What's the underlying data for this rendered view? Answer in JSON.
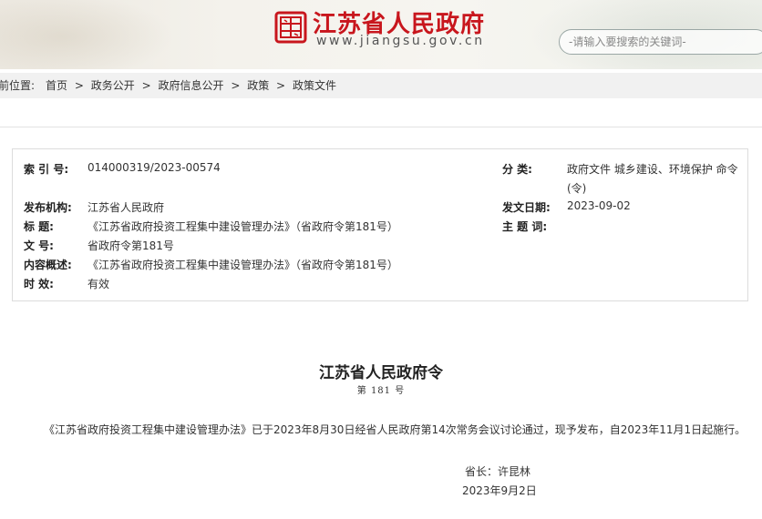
{
  "header": {
    "site_title": "江苏省人民政府",
    "site_url": "www.jiangsu.gov.cn",
    "search_placeholder": "-请输入要搜索的关键词-",
    "brand_color": "#c8161d"
  },
  "breadcrumb": {
    "label": "前位置:",
    "items": [
      "首页",
      "政务公开",
      "政府信息公开",
      "政策",
      "政策文件"
    ],
    "separator": ">"
  },
  "info": {
    "index_label": "索 引 号:",
    "index_value": "014000319/2023-00574",
    "category_label": "分 类:",
    "category_value_line1": "政府文件 城乡建设、环境保护 命令",
    "category_value_line2": "(令)",
    "publisher_label": "发布机构:",
    "publisher_value": "江苏省人民政府",
    "date_label": "发文日期:",
    "date_value": "2023-09-02",
    "title_label": "标 题:",
    "title_value": "《江苏省政府投资工程集中建设管理办法》（省政府令第181号）",
    "topic_label": "主 题 词:",
    "topic_value": "",
    "docno_label": "文 号:",
    "docno_value": "省政府令第181号",
    "summary_label": "内容概述:",
    "summary_value": "《江苏省政府投资工程集中建设管理办法》（省政府令第181号）",
    "validity_label": "时 效:",
    "validity_value": "有效"
  },
  "document": {
    "title": "江苏省人民政府令",
    "number": "第 181 号",
    "paragraph": "《江苏省政府投资工程集中建设管理办法》已于2023年8月30日经省人民政府第14次常务会议讨论通过，现予发布，自2023年11月1日起施行。",
    "signer": "省长：许昆林",
    "date": "2023年9月2日"
  }
}
